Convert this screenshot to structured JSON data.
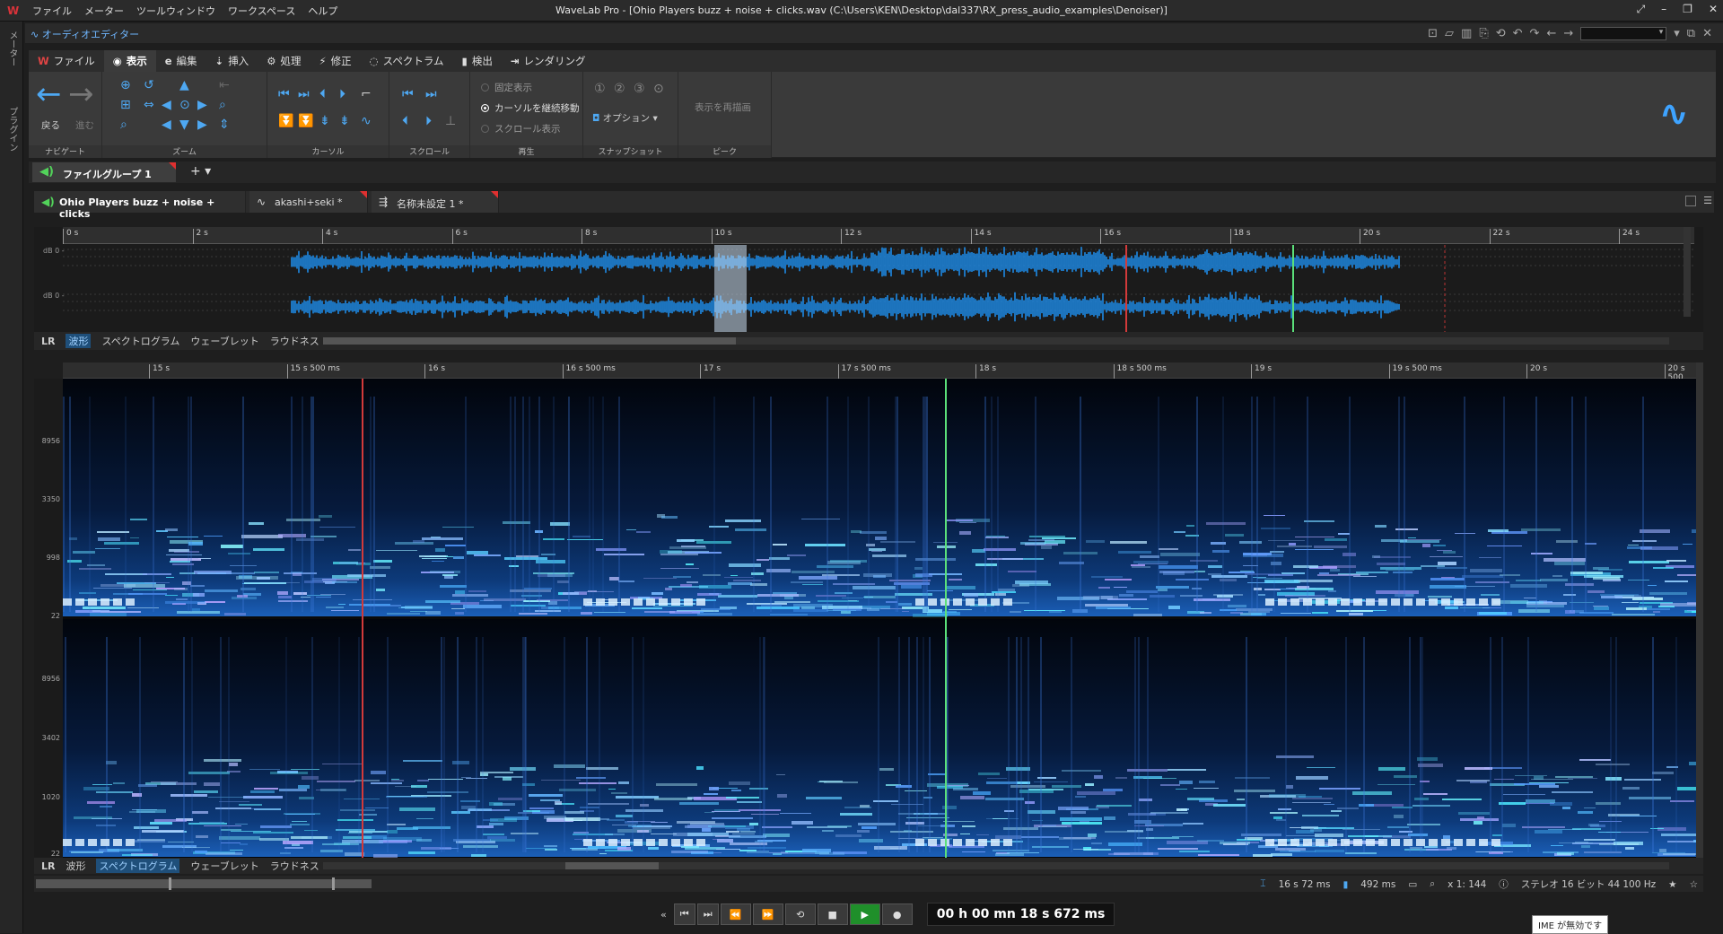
{
  "app": {
    "title": "WaveLab Pro - [Ohio Players buzz + noise + clicks.wav (C:\\Users\\KEN\\Desktop\\dal337\\RX_press_audio_examples\\Denoiser)]",
    "menu": [
      "ファイル",
      "メーター",
      "ツールウィンドウ",
      "ワークスペース",
      "ヘルプ"
    ],
    "left_strip": [
      "メーター",
      "プラグイン"
    ]
  },
  "editor": {
    "title": "オーディオエディター"
  },
  "ribbon": {
    "tabs": [
      {
        "label": "ファイル",
        "icon": "W"
      },
      {
        "label": "表示",
        "icon": "◉",
        "active": true
      },
      {
        "label": "編集",
        "icon": "e"
      },
      {
        "label": "挿入",
        "icon": "⇣"
      },
      {
        "label": "処理",
        "icon": "⚙"
      },
      {
        "label": "修正",
        "icon": "⚡"
      },
      {
        "label": "スペクトラム",
        "icon": "◌"
      },
      {
        "label": "検出",
        "icon": "▮"
      },
      {
        "label": "レンダリング",
        "icon": "⇥"
      }
    ],
    "nav": {
      "back": "戻る",
      "forward": "進む",
      "label": "ナビゲート"
    },
    "zoom_label": "ズーム",
    "cursor_label": "カーソル",
    "scroll_label": "スクロール",
    "playback": {
      "label": "再生",
      "options": [
        "固定表示",
        "カーソルを継続移動",
        "スクロール表示"
      ],
      "selected": 1
    },
    "snapshot": {
      "label": "スナップショット",
      "options": "オプション"
    },
    "peak": {
      "label": "ピーク",
      "redraw": "表示を再描画"
    }
  },
  "file_group": {
    "label": "ファイルグループ 1"
  },
  "doc_tabs": [
    {
      "label": "Ohio Players buzz + noise + clicks",
      "active": true
    },
    {
      "label": "akashi+seki *"
    },
    {
      "label": "名称未設定 1 *"
    }
  ],
  "overview_ruler": [
    "0 s",
    "2 s",
    "4 s",
    "6 s",
    "8 s",
    "10 s",
    "12 s",
    "14 s",
    "16 s",
    "18 s",
    "20 s",
    "22 s",
    "24 s"
  ],
  "overview_db": [
    "dB 0 -",
    "dB 0 -"
  ],
  "view_tabs_top": {
    "lr": "LR",
    "tabs": [
      "波形",
      "スペクトログラム",
      "ウェーブレット",
      "ラウドネス"
    ],
    "active": 0
  },
  "view_tabs_bottom": {
    "lr": "LR",
    "tabs": [
      "波形",
      "スペクトログラム",
      "ウェーブレット",
      "ラウドネス"
    ],
    "active": 1
  },
  "detail_ruler": [
    "15 s",
    "15 s 500 ms",
    "16 s",
    "16 s 500 ms",
    "17 s",
    "17 s 500 ms",
    "18 s",
    "18 s 500 ms",
    "19 s",
    "19 s 500 ms",
    "20 s",
    "20 s 500"
  ],
  "freq_labels_top": [
    "8956",
    "3350",
    "998",
    "22"
  ],
  "freq_labels_bottom": [
    "8956",
    "3402",
    "1020",
    "22"
  ],
  "status": {
    "position": "16 s 72 ms",
    "length": "492 ms",
    "zoom": "x 1: 144",
    "format": "ステレオ 16 ビット 44 100 Hz"
  },
  "transport": {
    "timecode": "00 h 00 mn 18 s 672 ms"
  },
  "ime": "IME が無効です",
  "colors": {
    "accent": "#4ea8f2",
    "cursor_red": "#d23a3a",
    "cursor_green": "#5be07a",
    "wave": "#1e8ae6"
  }
}
